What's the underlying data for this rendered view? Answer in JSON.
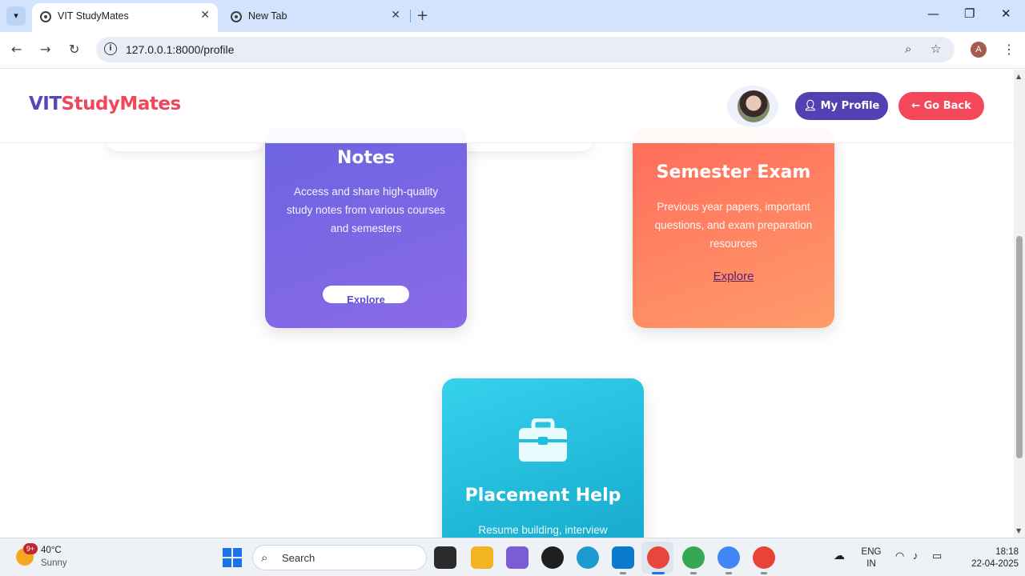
{
  "browser": {
    "tabs": [
      {
        "title": "VIT StudyMates",
        "active": true
      },
      {
        "title": "New Tab",
        "active": false
      }
    ],
    "url": "127.0.0.1:8000/profile",
    "profile_initial": "A"
  },
  "header": {
    "logo_part1": "VIT",
    "logo_part2": "StudyMates",
    "profile_button": "My Profile",
    "back_button": "Go Back"
  },
  "cards": {
    "notes": {
      "title": "Notes",
      "description": "Access and share high-quality study notes from various courses and semesters",
      "action": "Explore"
    },
    "exam": {
      "title": "Semester Exam",
      "description": "Previous year papers, important questions, and exam preparation resources",
      "action": "Explore"
    },
    "placement": {
      "title": "Placement Help",
      "description": "Resume building, interview"
    }
  },
  "taskbar": {
    "weather_badge": "9+",
    "temperature": "40°C",
    "condition": "Sunny",
    "search_label": "Search",
    "lang_line1": "ENG",
    "lang_line2": "IN",
    "time": "18:18",
    "date": "22-04-2025"
  },
  "colors": {
    "brand_primary": "#5241b1",
    "brand_accent": "#f5475a",
    "notes_card": "#7466e4",
    "exam_card": "#ff7f5f",
    "placement_card": "#22bedd"
  }
}
